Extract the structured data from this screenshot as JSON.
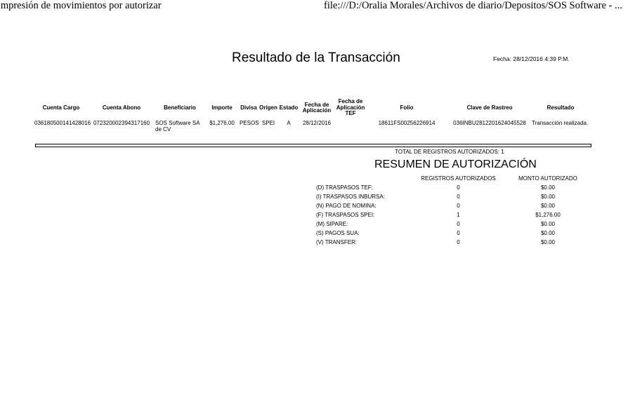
{
  "browser_header": {
    "left_title": "Impresión de movimientos por autorizar",
    "right_url": "file:///D:/Oralia Morales/Archivos de diario/Depositos/SOS Software - ..."
  },
  "report": {
    "title": "Resultado de la Transacción",
    "fecha": "Fecha: 28/12/2016 4:39 P.M."
  },
  "transactions": {
    "columns": [
      "Cuenta Cargo",
      "Cuenta Abono",
      "Beneficiario",
      "Importe",
      "Divisa",
      "Origen",
      "Estado",
      "Fecha de Aplicación",
      "Fecha de Aplicación TEF",
      "Folio",
      "Clave de Rastreo",
      "Resultado"
    ],
    "rows": [
      {
        "cuenta_cargo": "036180500141428016",
        "cuenta_abono": "072320002394317160",
        "beneficiario": "SOS Software SA de CV",
        "importe": "$1,276.00",
        "divisa": "PESOS",
        "origen": "SPEI",
        "estado": "A",
        "fecha_aplicacion": "28/12/2016",
        "fecha_aplicacion_tef": "",
        "folio": "18611FS00256226914",
        "clave_rastreo": "036INBU2812201624045528",
        "resultado": "Transacción realizada."
      }
    ]
  },
  "summary": {
    "total_label": "TOTAL DE REGISTROS AUTORIZADOS: 1",
    "title": "RESUMEN DE AUTORIZACIÓN",
    "col_registros": "REGISTROS AUTORIZADOS",
    "col_monto": "MONTO AUTORIZADO",
    "rows": [
      {
        "label": "(D) TRASPASOS TEF:",
        "registros": "0",
        "monto": "$0.00"
      },
      {
        "label": "(I) TRASPASOS INBURSA:",
        "registros": "0",
        "monto": "$0.00"
      },
      {
        "label": "(N) PAGO DE NOMINA:",
        "registros": "0",
        "monto": "$0.00"
      },
      {
        "label": "(F) TRASPASOS SPEI:",
        "registros": "1",
        "monto": "$1,276.00"
      },
      {
        "label": "(M) SIPARE:",
        "registros": "0",
        "monto": "$0.00"
      },
      {
        "label": "(S) PAGOS SUA:",
        "registros": "0",
        "monto": "$0.00"
      },
      {
        "label": "(V) TRANSFER:",
        "registros": "0",
        "monto": "$0.00"
      }
    ]
  }
}
